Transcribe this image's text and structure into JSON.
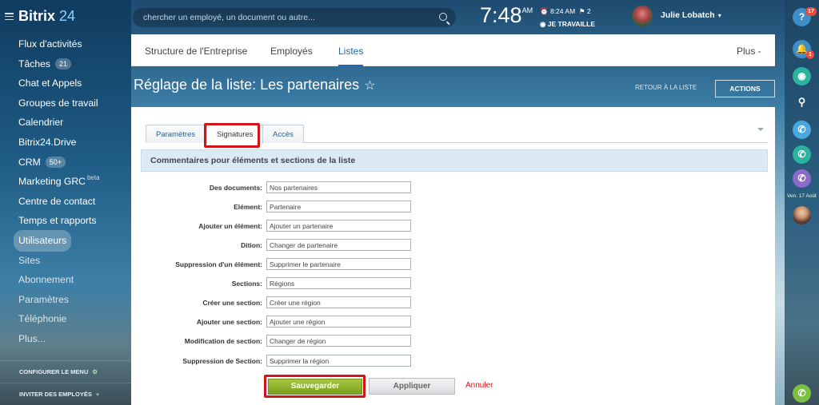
{
  "app": {
    "logo_main": "Bitrix",
    "logo_accent": "24"
  },
  "sidebar": {
    "items": [
      {
        "label": "Flux d'activités"
      },
      {
        "label": "Tâches",
        "count": "21"
      },
      {
        "label": "Chat et Appels"
      },
      {
        "label": "Groupes de travail"
      },
      {
        "label": "Calendrier"
      },
      {
        "label": "Bitrix24.Drive"
      },
      {
        "label": "CRM",
        "count": "50+"
      },
      {
        "label": "Marketing GRC",
        "tag": "beta"
      },
      {
        "label": "Centre de contact"
      },
      {
        "label": "Temps et rapports"
      },
      {
        "label": "Utilisateurs"
      },
      {
        "label": "Sites"
      },
      {
        "label": "Abonnement"
      },
      {
        "label": "Paramètres"
      },
      {
        "label": "Téléphonie"
      },
      {
        "label": "Plus..."
      }
    ],
    "configure_menu": "CONFIGURER LE MENU",
    "invite": "INVITER DES EMPLOYÉS"
  },
  "topbar": {
    "search_placeholder": "chercher un employé, un document ou autre...",
    "time": "7:48",
    "ampm": "AM",
    "alarm": "8:24 AM",
    "flags": "2",
    "work_status": "JE TRAVAILLE",
    "user_name": "Julie Lobatch"
  },
  "rail": {
    "help_badge": "17",
    "bell_badge": "1",
    "date": "Ven. 17 Août"
  },
  "nav": {
    "tabs": [
      "Structure de l'Entreprise",
      "Employés",
      "Listes"
    ],
    "more": "Plus"
  },
  "page": {
    "title": "Réglage de la liste: Les partenaires",
    "back_link": "RETOUR À LA LISTE",
    "actions": "ACTIONS"
  },
  "form": {
    "tabs": [
      "Paramètres",
      "Signatures",
      "Accès"
    ],
    "section_title": "Commentaires pour éléments et sections de la liste",
    "fields": [
      {
        "label": "Des documents:",
        "value": "Nos partenaires"
      },
      {
        "label": "Elément:",
        "value": "Partenaire"
      },
      {
        "label": "Ajouter un élément:",
        "value": "Ajouter un partenaire"
      },
      {
        "label": "Dition:",
        "value": "Changer de partenaire"
      },
      {
        "label": "Suppression d'un élément:",
        "value": "Supprimer le partenaire"
      },
      {
        "label": "Sections:",
        "value": "Régions"
      },
      {
        "label": "Créer une section:",
        "value": "Créer une région"
      },
      {
        "label": "Ajouter une section:",
        "value": "Ajouter une région"
      },
      {
        "label": "Modification de section:",
        "value": "Changer de région"
      },
      {
        "label": "Suppression de Section:",
        "value": "Supprimer la région"
      }
    ],
    "save": "Sauvegarder",
    "apply": "Appliquer",
    "cancel": "Annuler"
  }
}
